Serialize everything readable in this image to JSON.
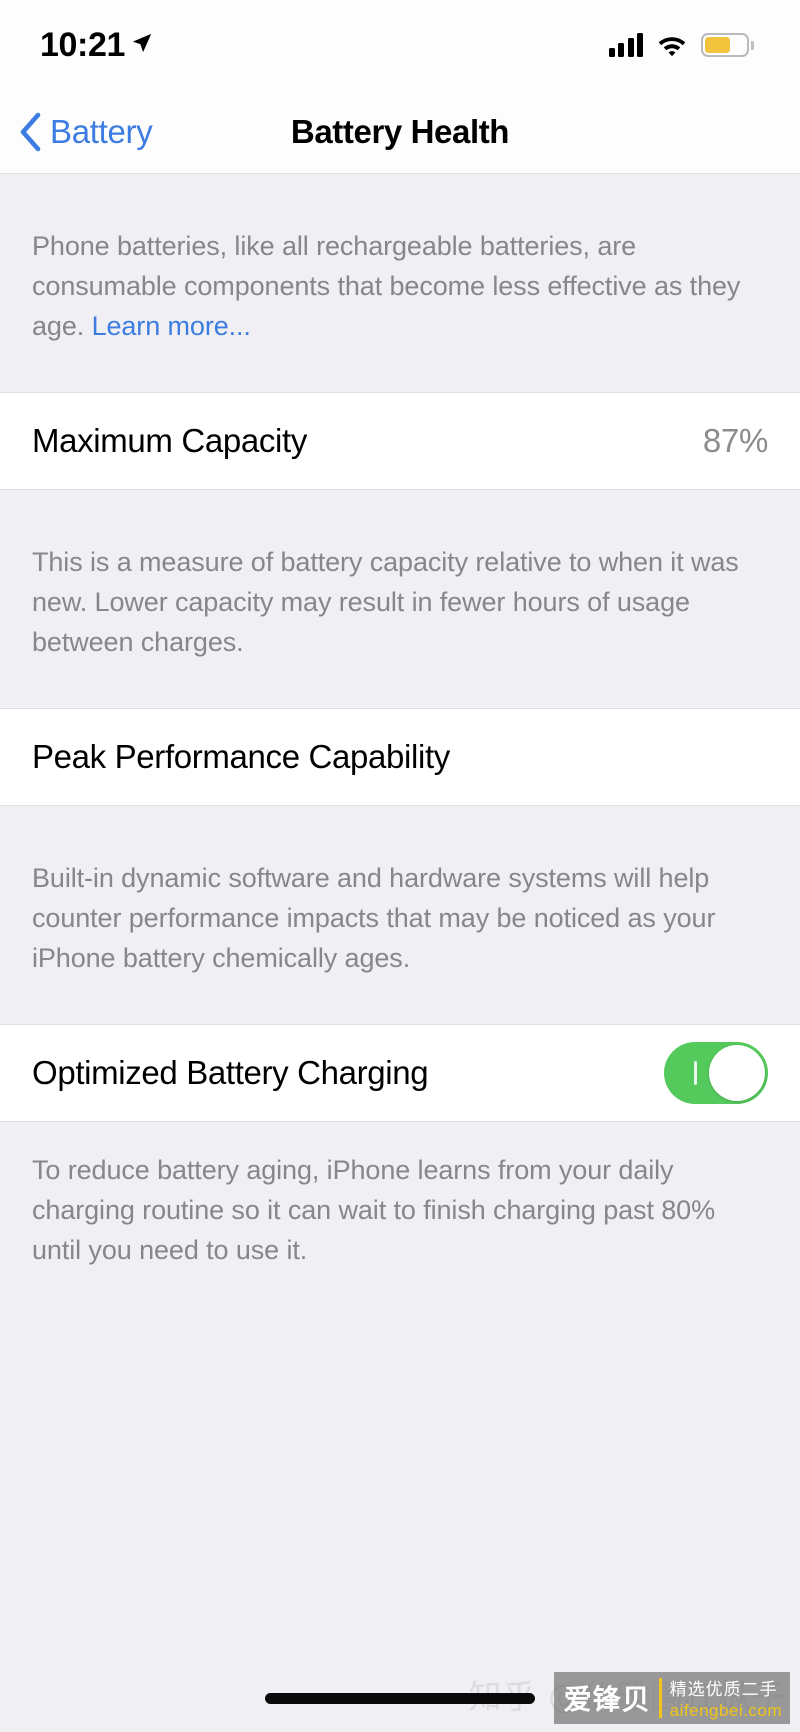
{
  "statusbar": {
    "time": "10:21",
    "location_icon": "location-arrow-icon",
    "cellular_icon": "cellular-signal-icon",
    "wifi_icon": "wifi-icon",
    "battery_icon": "battery-icon",
    "battery_level_percent": 62,
    "battery_color": "#f2c43d"
  },
  "navbar": {
    "back_label": "Battery",
    "back_icon": "chevron-left-icon",
    "title": "Battery Health",
    "accent_color": "#3d7ce0"
  },
  "intro": {
    "text": "Phone batteries, like all rechargeable batteries, are consumable components that become less effective as they age. ",
    "link_label": "Learn more..."
  },
  "maximum_capacity": {
    "label": "Maximum Capacity",
    "value": "87%",
    "footnote": "This is a measure of battery capacity relative to when it was new. Lower capacity may result in fewer hours of usage between charges."
  },
  "peak_performance": {
    "label": "Peak Performance Capability",
    "footnote": "Built-in dynamic software and hardware systems will help counter performance impacts that may be noticed as your iPhone battery chemically ages."
  },
  "optimized_charging": {
    "label": "Optimized Battery Charging",
    "toggle_state": "on",
    "toggle_color": "#55ca5c",
    "footnote": "To reduce battery aging, iPhone learns from your daily charging routine so it can wait to finish charging past 80% until you need to use it."
  },
  "watermarks": {
    "zhihu": "知乎 @仏雅園杠枞子",
    "brand_name": "爱锋贝",
    "brand_tagline": "精选优质二手",
    "brand_site": "aifengbei.com"
  }
}
